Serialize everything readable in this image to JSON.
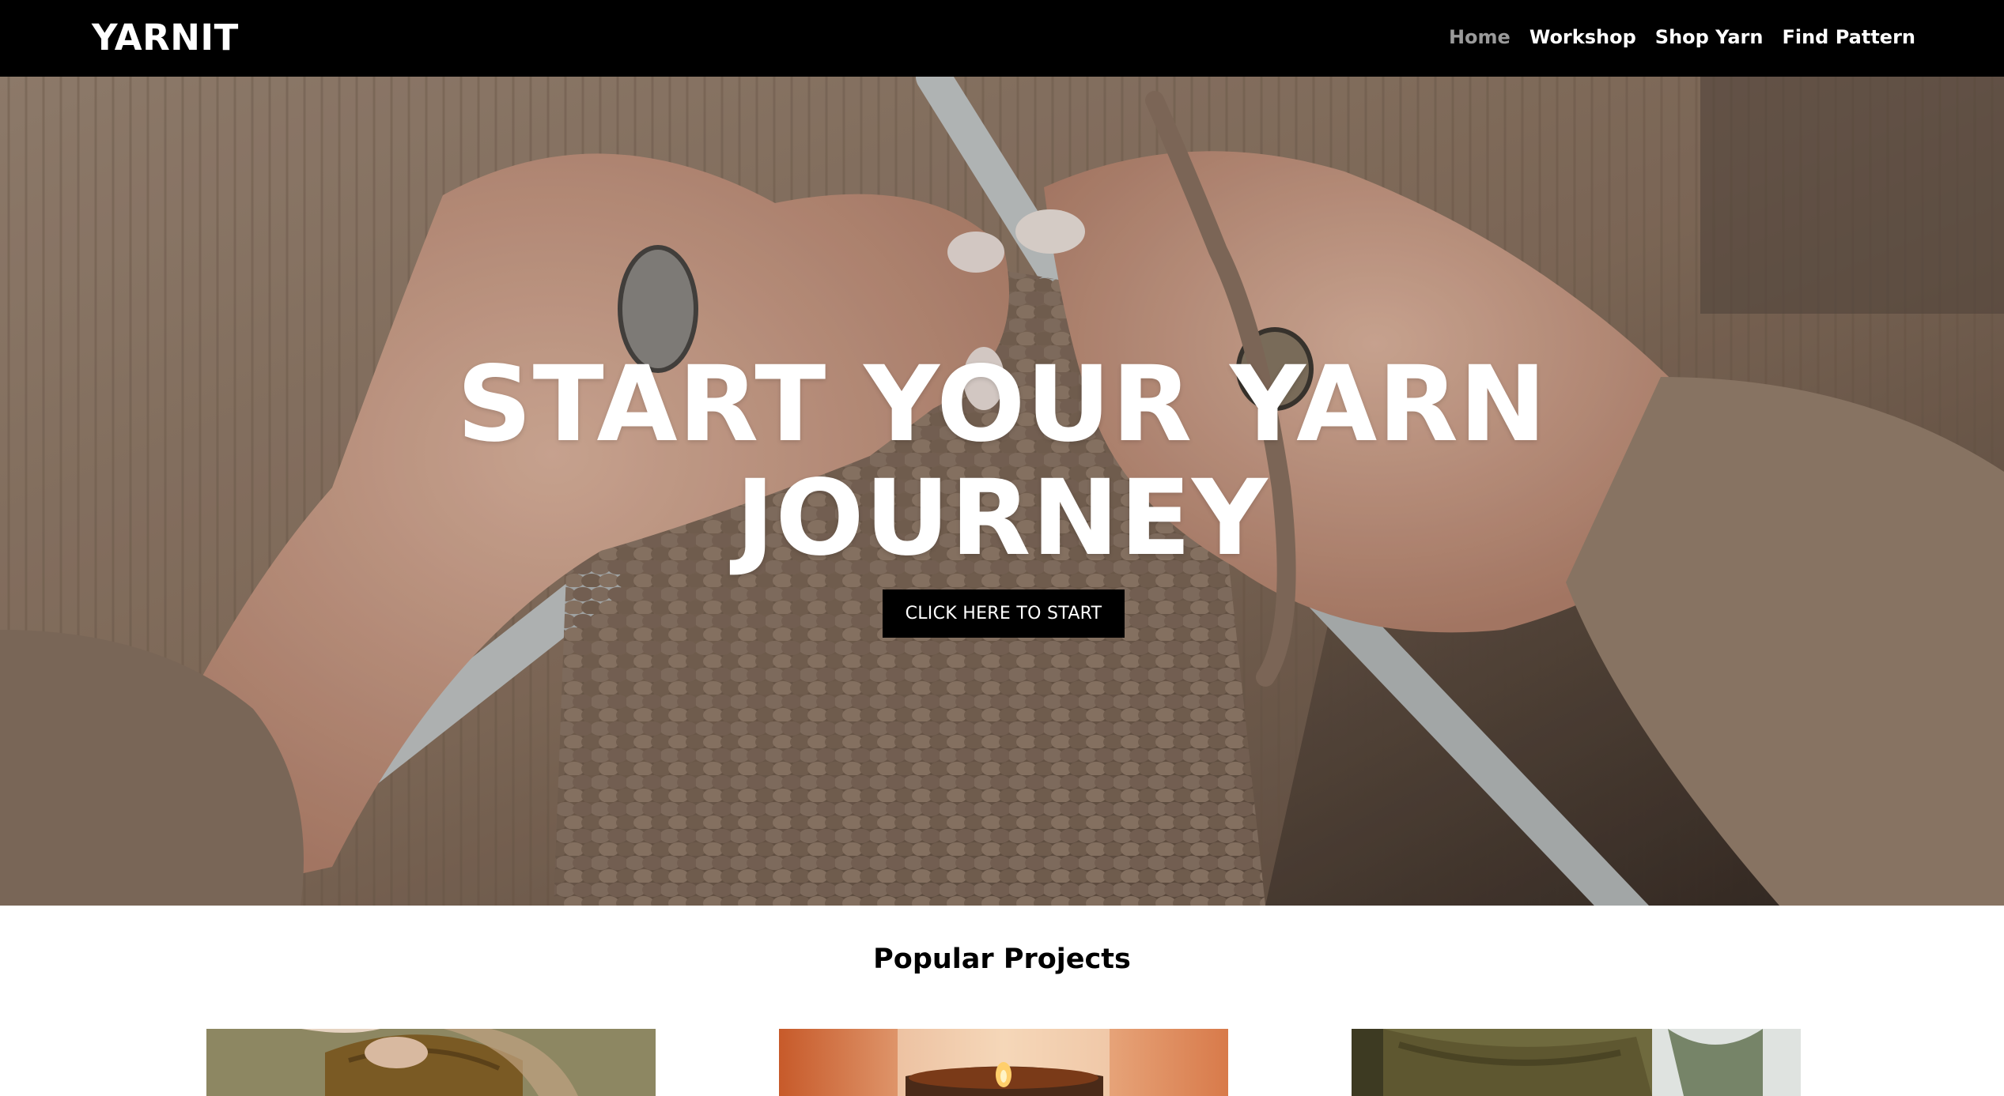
{
  "brand": "YARNIT",
  "nav": {
    "items": [
      {
        "label": "Home",
        "active": true
      },
      {
        "label": "Workshop",
        "active": false
      },
      {
        "label": "Shop Yarn",
        "active": false
      },
      {
        "label": "Find Pattern",
        "active": false
      }
    ]
  },
  "hero": {
    "title_line1": "START YOUR YARN",
    "title_line2": "JOURNEY",
    "cta_label": "CLICK HERE TO START",
    "image": "hands-knitting-photo"
  },
  "projects": {
    "title": "Popular Projects",
    "cards": [
      {
        "image": "knit-sweater-photo"
      },
      {
        "image": "candle-photo"
      },
      {
        "image": "olive-knit-photo"
      }
    ]
  },
  "colors": {
    "nav_bg": "#000000",
    "nav_active": "#9a9a9a",
    "text_light": "#ffffff",
    "button_bg": "#000000"
  }
}
